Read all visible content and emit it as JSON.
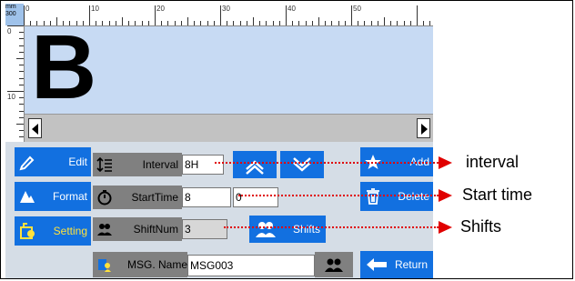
{
  "ruler": {
    "unit_top": "mm",
    "unit_bottom": "300",
    "h_labels": [
      "0",
      "10",
      "20",
      "30",
      "40",
      "50"
    ],
    "v_labels": [
      "0",
      "10"
    ]
  },
  "canvas": {
    "text": "B"
  },
  "nav": {
    "edit": "Edit",
    "format": "Format",
    "setting": "Setting"
  },
  "settings": {
    "interval_label": "Interval",
    "interval_value": "8H",
    "starttime_label": "StartTime",
    "starttime_hour": "8",
    "starttime_min": "0",
    "shiftnum_label": "ShiftNum",
    "shiftnum_value": "3",
    "shifts_button": "Shifts"
  },
  "actions": {
    "add": "Add",
    "delete": "Delete",
    "return": "Return"
  },
  "message": {
    "label": "MSG. Name",
    "value": "MSG003"
  },
  "annotations": {
    "interval": "interval",
    "start_time": "Start time",
    "shifts": "Shifts"
  },
  "colors": {
    "accent": "#1270e0",
    "annotation": "#e00000",
    "active_nav_text": "#ffe23c"
  }
}
